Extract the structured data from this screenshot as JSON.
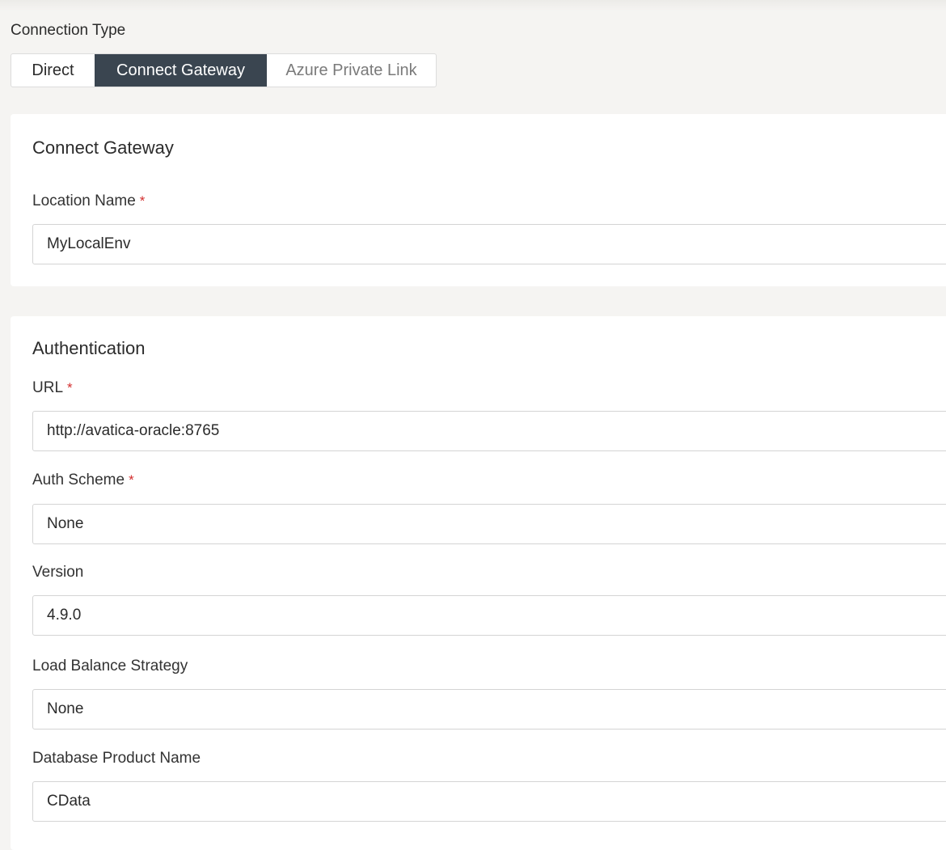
{
  "connection_type": {
    "label": "Connection Type",
    "options": [
      "Direct",
      "Connect Gateway",
      "Azure Private Link"
    ],
    "selected": "Connect Gateway"
  },
  "gateway": {
    "title": "Connect Gateway",
    "location_name": {
      "label": "Location Name",
      "required_mark": "*",
      "value": "MyLocalEnv"
    }
  },
  "auth": {
    "title": "Authentication",
    "url": {
      "label": "URL",
      "required_mark": "*",
      "value": "http://avatica-oracle:8765"
    },
    "auth_scheme": {
      "label": "Auth Scheme",
      "required_mark": "*",
      "value": "None"
    },
    "version": {
      "label": "Version",
      "value": "4.9.0"
    },
    "load_balance": {
      "label": "Load Balance Strategy",
      "value": "None"
    },
    "db_product_name": {
      "label": "Database Product Name",
      "value": "CData"
    }
  },
  "colors": {
    "selected_segment_bg": "#3a4550",
    "required_mark": "#d32f2f",
    "page_bg": "#f5f4f2"
  }
}
